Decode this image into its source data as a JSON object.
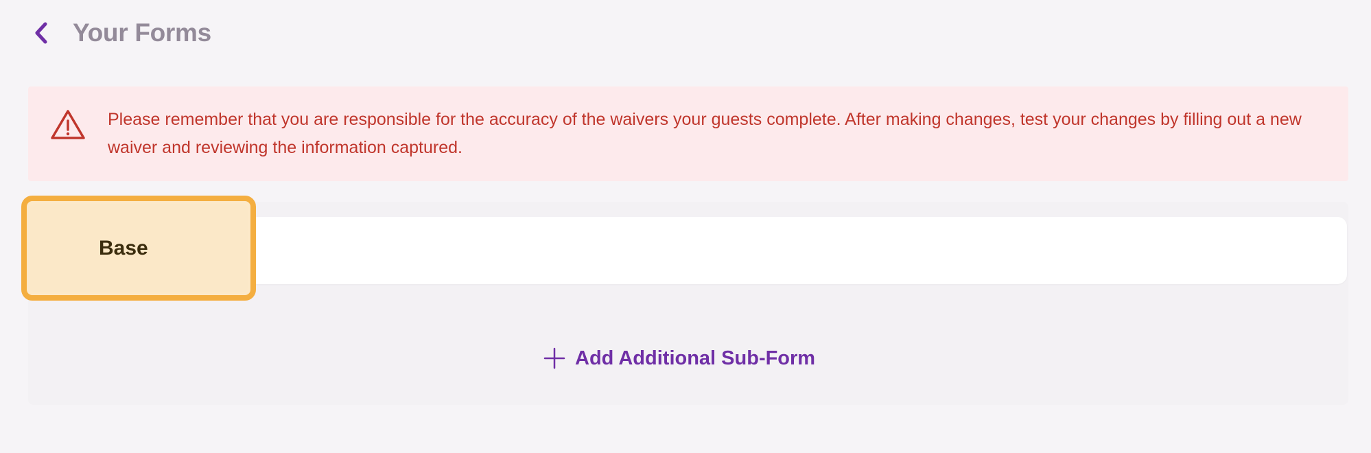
{
  "header": {
    "title": "Your Forms",
    "back_icon": "chevron-left-icon"
  },
  "alert": {
    "icon": "warning-triangle-icon",
    "message": "Please remember that you are responsible for the accuracy of the waivers your guests complete. After making changes, test your changes by filling out a new waiver and reviewing the information captured."
  },
  "tabs": [
    {
      "label": "Base",
      "selected": true
    }
  ],
  "add_subform": {
    "icon": "plus-icon",
    "label": "Add Additional Sub-Form"
  },
  "colors": {
    "accent": "#6f2fa6",
    "alert_text": "#c0362c",
    "alert_bg": "#fdeaec",
    "selected_tab_border": "#f4ae40",
    "selected_tab_bg": "#fbe8c8"
  }
}
